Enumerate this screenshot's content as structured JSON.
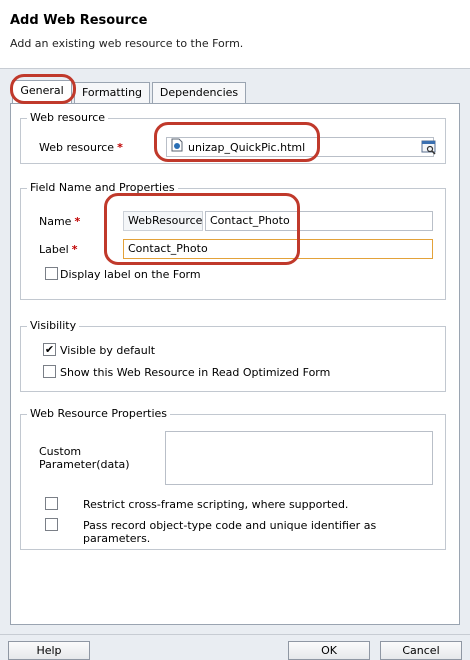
{
  "header": {
    "title": "Add Web Resource",
    "subtitle": "Add an existing web resource to the Form."
  },
  "tabs": [
    {
      "label": "General",
      "active": true
    },
    {
      "label": "Formatting",
      "active": false
    },
    {
      "label": "Dependencies",
      "active": false
    }
  ],
  "web_resource_section": {
    "legend": "Web resource",
    "label": "Web resource",
    "required_mark": "*",
    "value": "unizap_QuickPic.html",
    "file_icon": "web-page-icon",
    "lookup_icon": "lookup-icon"
  },
  "field_section": {
    "legend": "Field Name and Properties",
    "name_label": "Name",
    "name_prefix": "WebResource_",
    "name_value": "Contact_Photo",
    "label_label": "Label",
    "label_value": "Contact_Photo",
    "required_mark": "*",
    "display_label_text": "Display label on the Form",
    "display_label_checked": false
  },
  "visibility_section": {
    "legend": "Visibility",
    "visible_default_text": "Visible by default",
    "visible_default_checked": true,
    "read_optimized_text": "Show this Web Resource in Read Optimized Form",
    "read_optimized_checked": false
  },
  "properties_section": {
    "legend": "Web Resource Properties",
    "custom_param_label": "Custom Parameter(data)",
    "custom_param_value": "",
    "restrict_text": "Restrict cross-frame scripting, where supported.",
    "restrict_checked": false,
    "pass_record_text": "Pass record object-type code and unique identifier as parameters.",
    "pass_record_checked": false
  },
  "footer": {
    "help_label": "Help",
    "ok_label": "OK",
    "cancel_label": "Cancel"
  },
  "colors": {
    "required": "#c00000",
    "highlight": "#c0392b",
    "focus_border": "#e3a23a"
  }
}
